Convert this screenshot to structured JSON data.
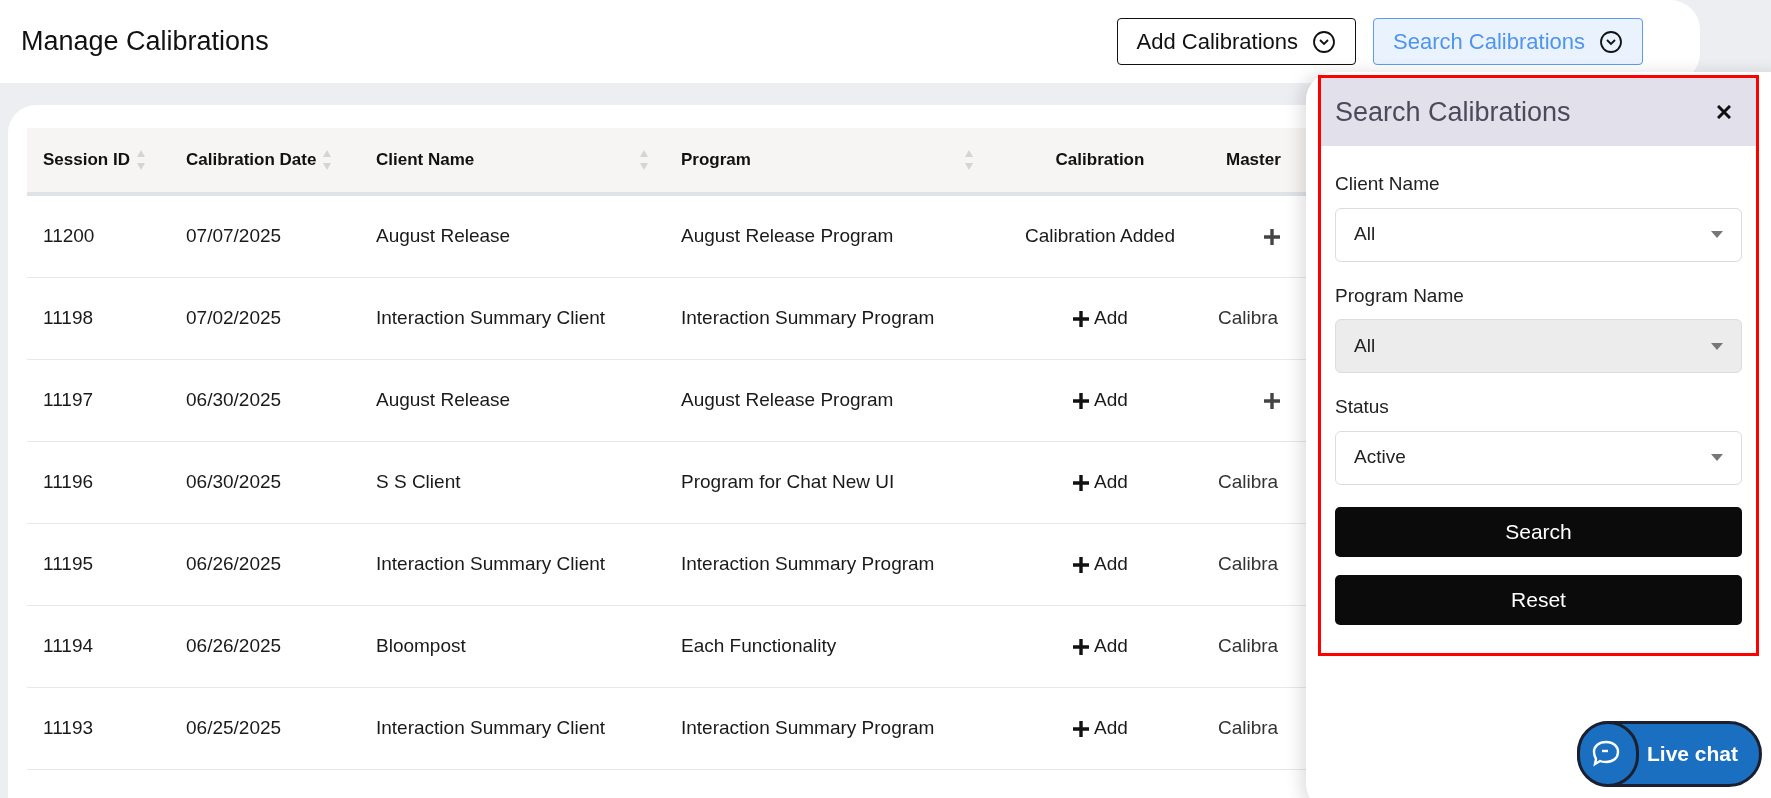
{
  "page_title": "Manage Calibrations",
  "header_buttons": [
    {
      "label": "Add Calibrations",
      "selected": false
    },
    {
      "label": "Search Calibrations",
      "selected": true
    }
  ],
  "table": {
    "columns": [
      {
        "label": "Session ID",
        "sortable": true
      },
      {
        "label": "Calibration Date",
        "sortable": true
      },
      {
        "label": "Client Name",
        "sortable": true
      },
      {
        "label": "Program",
        "sortable": true
      },
      {
        "label": "Calibration",
        "sortable": false
      },
      {
        "label": "Master",
        "sortable": false
      }
    ],
    "rows": [
      {
        "session_id": "11200",
        "date": "07/07/2025",
        "client": "August Release",
        "program": "August Release Program",
        "calibration": {
          "kind": "text",
          "text": "Calibration Added"
        },
        "master": {
          "kind": "add"
        }
      },
      {
        "session_id": "11198",
        "date": "07/02/2025",
        "client": "Interaction Summary Client",
        "program": "Interaction Summary Program",
        "calibration": {
          "kind": "add",
          "text": "Add"
        },
        "master": {
          "kind": "text",
          "text": "Calibra"
        }
      },
      {
        "session_id": "11197",
        "date": "06/30/2025",
        "client": "August Release",
        "program": "August Release Program",
        "calibration": {
          "kind": "add",
          "text": "Add"
        },
        "master": {
          "kind": "add"
        }
      },
      {
        "session_id": "11196",
        "date": "06/30/2025",
        "client": "S S Client",
        "program": "Program for Chat New UI",
        "calibration": {
          "kind": "add",
          "text": "Add"
        },
        "master": {
          "kind": "text",
          "text": "Calibra"
        }
      },
      {
        "session_id": "11195",
        "date": "06/26/2025",
        "client": "Interaction Summary Client",
        "program": "Interaction Summary Program",
        "calibration": {
          "kind": "add",
          "text": "Add"
        },
        "master": {
          "kind": "text",
          "text": "Calibra"
        }
      },
      {
        "session_id": "11194",
        "date": "06/26/2025",
        "client": "Bloompost",
        "program": "Each Functionality",
        "calibration": {
          "kind": "add",
          "text": "Add"
        },
        "master": {
          "kind": "text",
          "text": "Calibra"
        }
      },
      {
        "session_id": "11193",
        "date": "06/25/2025",
        "client": "Interaction Summary Client",
        "program": "Interaction Summary Program",
        "calibration": {
          "kind": "add",
          "text": "Add"
        },
        "master": {
          "kind": "text",
          "text": "Calibra"
        }
      }
    ]
  },
  "search_panel": {
    "title": "Search Calibrations",
    "fields": [
      {
        "label": "Client Name",
        "value": "All",
        "disabled": false
      },
      {
        "label": "Program Name",
        "value": "All",
        "disabled": true
      },
      {
        "label": "Status",
        "value": "Active",
        "disabled": false
      }
    ],
    "buttons": [
      "Search",
      "Reset"
    ]
  },
  "live_chat": {
    "label": "Live chat"
  }
}
